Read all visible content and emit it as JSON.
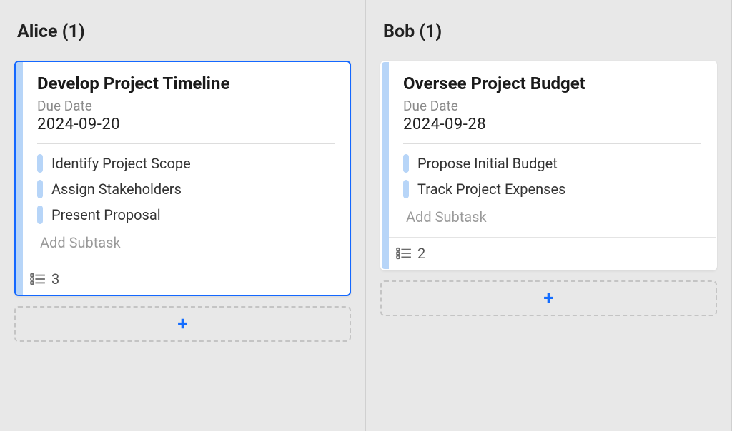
{
  "labels": {
    "due_date": "Due Date",
    "add_subtask": "Add Subtask"
  },
  "columns": [
    {
      "header": "Alice (1)",
      "card": {
        "selected": true,
        "title": "Develop Project Timeline",
        "due": "2024-09-20",
        "subtasks": [
          "Identify Project Scope",
          "Assign Stakeholders",
          "Present Proposal"
        ],
        "count": "3"
      }
    },
    {
      "header": "Bob (1)",
      "card": {
        "selected": false,
        "title": "Oversee Project Budget",
        "due": "2024-09-28",
        "subtasks": [
          "Propose Initial Budget",
          "Track Project Expenses"
        ],
        "count": "2"
      }
    }
  ]
}
